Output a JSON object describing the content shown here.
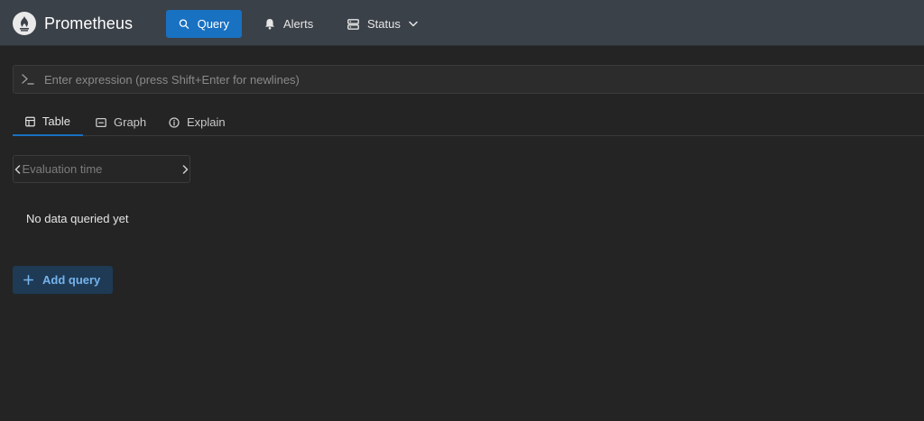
{
  "header": {
    "brand_title": "Prometheus",
    "nav": {
      "query_label": "Query",
      "alerts_label": "Alerts",
      "status_label": "Status"
    }
  },
  "expression": {
    "placeholder": "Enter expression (press Shift+Enter for newlines)",
    "value": ""
  },
  "tabs": {
    "table_label": "Table",
    "graph_label": "Graph",
    "explain_label": "Explain",
    "active": "Table"
  },
  "evaluation": {
    "placeholder": "Evaluation time",
    "value": ""
  },
  "results": {
    "message": "No data queried yet"
  },
  "actions": {
    "add_query_label": "Add query"
  },
  "colors": {
    "accent": "#1971c2",
    "header_bg": "#3b4149",
    "page_bg": "#242424",
    "add_query_text": "#74b4ec"
  },
  "icons": {
    "brand": "prometheus-flame-icon",
    "query": "search-icon",
    "alerts": "bell-icon",
    "status": "server-icon",
    "expression": "terminal-prompt-icon",
    "table": "table-icon",
    "graph": "chart-icon",
    "explain": "info-circle-icon",
    "add_query": "plus-icon"
  }
}
